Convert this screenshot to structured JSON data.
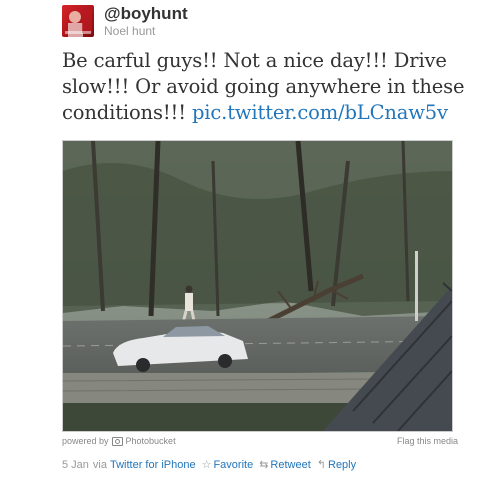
{
  "user": {
    "handle": "@boyhunt",
    "name": "Noel hunt"
  },
  "tweet": {
    "text": "Be carful guys!! Not a nice day!!! Drive slow!!! Or avoid going anywhere in these conditions!!!",
    "link": "pic.twitter.com/bLCnaw5v"
  },
  "media": {
    "powered_by": "powered by",
    "provider": "Photobucket",
    "flag": "Flag this media"
  },
  "meta": {
    "date": "5 Jan",
    "via": "via",
    "source": "Twitter for iPhone",
    "actions": [
      {
        "label": "Favorite",
        "icon": "star-icon"
      },
      {
        "label": "Retweet",
        "icon": "retweet-icon"
      },
      {
        "label": "Reply",
        "icon": "reply-icon"
      }
    ]
  },
  "colors": {
    "link": "#2276bb",
    "muted": "#999999",
    "avatar": "#d8242a"
  }
}
